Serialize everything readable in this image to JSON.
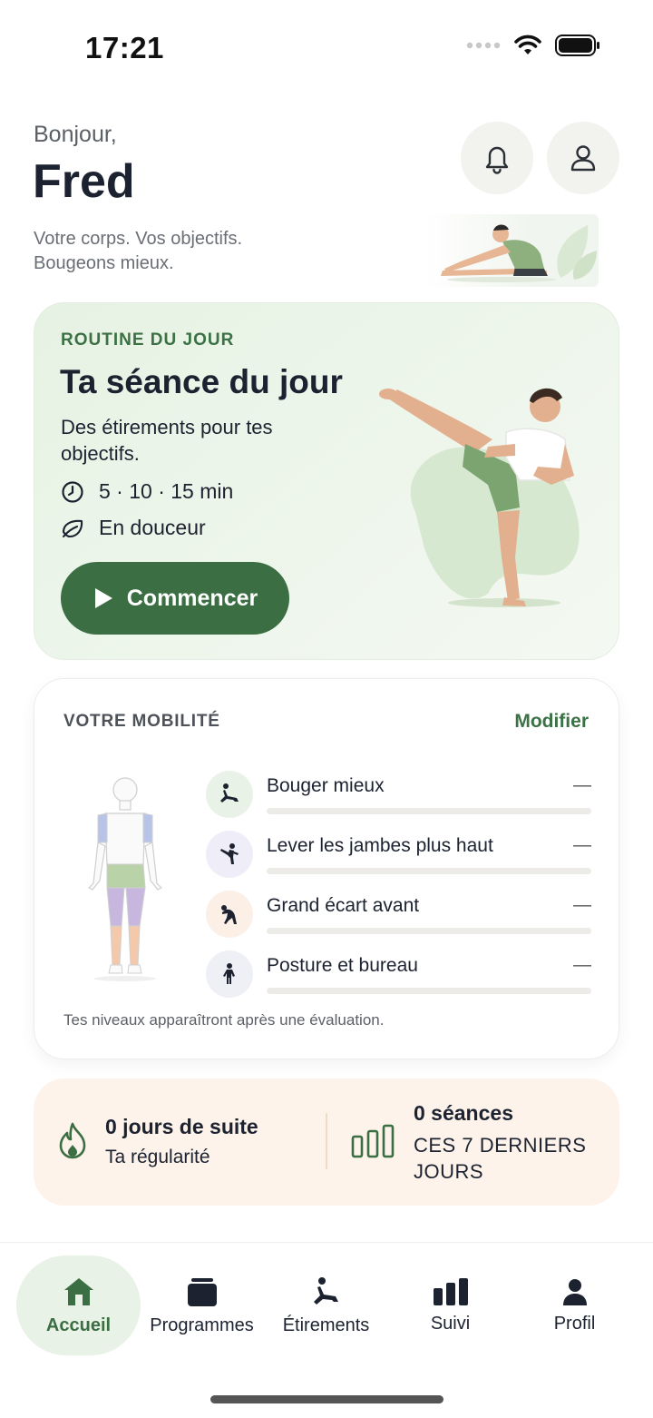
{
  "status_bar": {
    "time": "17:21"
  },
  "header": {
    "greeting": "Bonjour,",
    "user_name": "Fred",
    "tagline_line1": "Votre corps. Vos objectifs.",
    "tagline_line2": "Bougeons mieux."
  },
  "routine": {
    "label": "ROUTINE DU JOUR",
    "title": "Ta séance du jour",
    "description": "Des étirements pour tes objectifs.",
    "duration": "5 · 10 · 15 min",
    "intensity": "En douceur",
    "start_label": "Commencer"
  },
  "mobility": {
    "label": "VOTRE MOBILITÉ",
    "modify_label": "Modifier",
    "items": [
      {
        "name": "Bouger mieux",
        "value": "—",
        "icon": "stretch-lunge-icon",
        "icon_bg": "#e8f2e6",
        "level": 0
      },
      {
        "name": "Lever les jambes plus haut",
        "value": "—",
        "icon": "high-kick-icon",
        "icon_bg": "#efeef8",
        "level": 0
      },
      {
        "name": "Grand écart avant",
        "value": "—",
        "icon": "forward-bend-icon",
        "icon_bg": "#fcefe6",
        "level": 0
      },
      {
        "name": "Posture et bureau",
        "value": "—",
        "icon": "standing-person-icon",
        "icon_bg": "#eef0f6",
        "level": 0
      }
    ],
    "note": "Tes niveaux apparaîtront après une évaluation."
  },
  "stats": {
    "streak_title": "0 jours de suite",
    "streak_subtitle": "Ta régularité",
    "sessions_title": "0 séances",
    "sessions_subtitle": "CES 7 DERNIERS JOURS"
  },
  "tabs": [
    {
      "label": "Accueil",
      "icon": "home-icon",
      "active": true
    },
    {
      "label": "Programmes",
      "icon": "programs-icon",
      "active": false
    },
    {
      "label": "Étirements",
      "icon": "stretch-icon",
      "active": false
    },
    {
      "label": "Suivi",
      "icon": "stats-icon",
      "active": false
    },
    {
      "label": "Profil",
      "icon": "profile-icon",
      "active": false
    }
  ],
  "colors": {
    "accent": "#3b6e43",
    "routine_bg": "#e9f4e6",
    "stats_bg": "#fdf3ea"
  }
}
